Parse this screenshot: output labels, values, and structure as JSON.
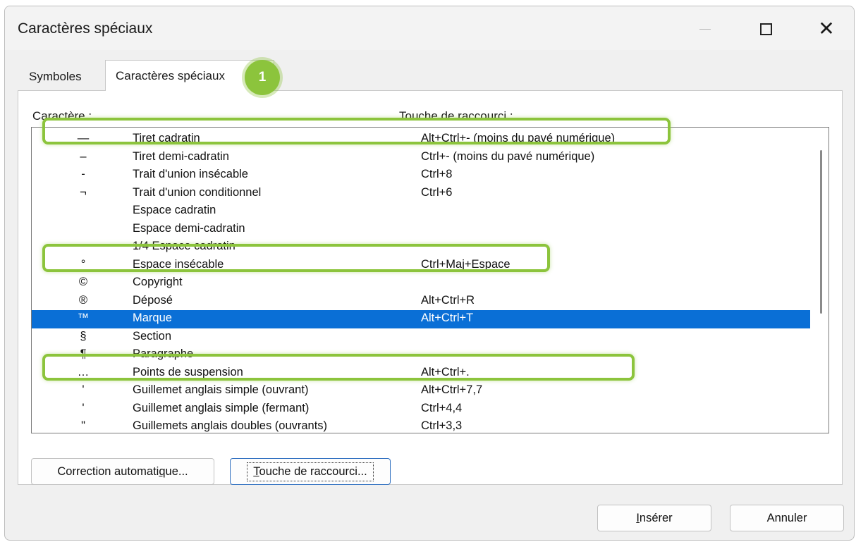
{
  "window": {
    "title": "Caractères spéciaux",
    "minimize_icon": "minimize-icon",
    "maximize_icon": "maximize-icon",
    "close_glyph": "✕"
  },
  "tabs": [
    {
      "label": "Symboles",
      "active": false
    },
    {
      "label": "Caractères spéciaux",
      "active": true
    }
  ],
  "badge": {
    "number": "1",
    "color": "#8cc43c"
  },
  "columns": {
    "character": "Caractère :",
    "shortcut": "Touche de raccourci :"
  },
  "rows": [
    {
      "char": "—",
      "name": "Tiret cadratin",
      "shortcut": "Alt+Ctrl+- (moins du pavé numérique)"
    },
    {
      "char": "–",
      "name": "Tiret demi-cadratin",
      "shortcut": "Ctrl+- (moins du pavé numérique)"
    },
    {
      "char": "-",
      "name": "Trait d'union insécable",
      "shortcut": "Ctrl+8"
    },
    {
      "char": "¬",
      "name": "Trait d'union conditionnel",
      "shortcut": "Ctrl+6"
    },
    {
      "char": "",
      "name": "Espace cadratin",
      "shortcut": ""
    },
    {
      "char": "",
      "name": "Espace demi-cadratin",
      "shortcut": ""
    },
    {
      "char": "",
      "name": "1/4 Espace cadratin",
      "shortcut": ""
    },
    {
      "char": "°",
      "name": "Espace insécable",
      "shortcut": "Ctrl+Maj+Espace"
    },
    {
      "char": "©",
      "name": "Copyright",
      "shortcut": ""
    },
    {
      "char": "®",
      "name": "Déposé",
      "shortcut": "Alt+Ctrl+R"
    },
    {
      "char": "™",
      "name": "Marque",
      "shortcut": "Alt+Ctrl+T"
    },
    {
      "char": "§",
      "name": "Section",
      "shortcut": ""
    },
    {
      "char": "¶",
      "name": "Paragraphe",
      "shortcut": ""
    },
    {
      "char": "…",
      "name": "Points de suspension",
      "shortcut": "Alt+Ctrl+."
    },
    {
      "char": "'",
      "name": "Guillemet anglais simple (ouvrant)",
      "shortcut": "Alt+Ctrl+7,7"
    },
    {
      "char": "'",
      "name": "Guillemet anglais simple (fermant)",
      "shortcut": "Ctrl+4,4"
    },
    {
      "char": "\"",
      "name": "Guillemets anglais doubles (ouvrants)",
      "shortcut": "Ctrl+3,3"
    }
  ],
  "selected_row": 10,
  "buttons": {
    "autocorrect_pre": "Correction automati",
    "autocorrect_ul": "q",
    "autocorrect_post": "ue...",
    "shortcut_ul": "T",
    "shortcut_post": "ouche de raccourci...",
    "insert_ul": "I",
    "insert_post": "nsérer",
    "cancel": "Annuler"
  },
  "colors": {
    "accent_highlight": "#8cc43c",
    "selection": "#0a6fd6"
  }
}
